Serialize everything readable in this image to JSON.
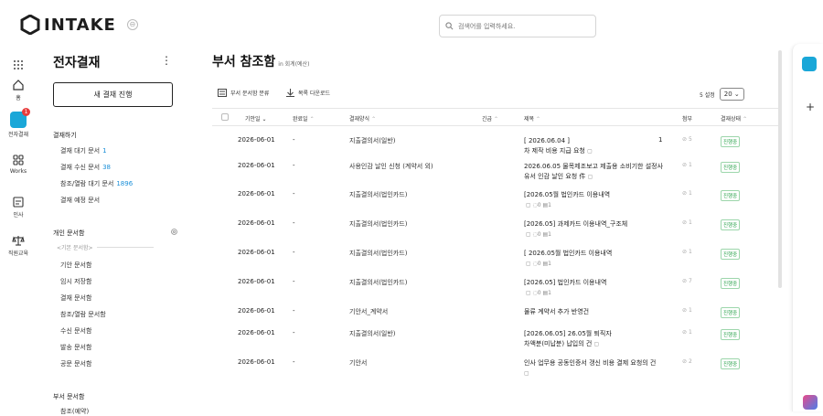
{
  "brand": {
    "name": "INTAKE"
  },
  "search": {
    "placeholder": "검색어를 입력하세요."
  },
  "rail": {
    "home": "홈",
    "approval": "전자결재",
    "approval_badge": "1",
    "works": "Works",
    "hr": "인사",
    "edu": "직원교육"
  },
  "sidebar": {
    "title": "전자결재",
    "new_button": "새 결재 진행",
    "section_approve": "결재하기",
    "items_approve": [
      {
        "label": "결재 대기 문서",
        "count": "1"
      },
      {
        "label": "결재 수신 문서",
        "count": "38"
      },
      {
        "label": "참조/열람 대기 문서",
        "count": "1896"
      },
      {
        "label": "결재 예정 문서",
        "count": ""
      }
    ],
    "section_personal": "개인 문서함",
    "divider_label": "<기본 문서함>",
    "items_personal": [
      "기안 문서함",
      "임시 저장함",
      "결재 문서함",
      "참조/열람 문서함",
      "수신 문서함",
      "발송 문서함",
      "공문 문서함"
    ],
    "section_dept": "부서 문서함",
    "dept_partial": "참조(예약)"
  },
  "main": {
    "title": "부서 참조함",
    "subtitle": "in 회계(예산)",
    "tool_classify": "부서 문서함 분류",
    "tool_download": "목록 다운로드",
    "page_size_label": "5 설정",
    "page_size": "20"
  },
  "table": {
    "headers": {
      "draft_date": "기안일",
      "done_date": "완료일",
      "form": "결재양식",
      "urgent": "긴급",
      "title": "제목",
      "attach": "첨부",
      "status": "결재상태"
    },
    "rows": [
      {
        "date": "2026-06-01",
        "done": "-",
        "form": "지출결의서(일반)",
        "title": "[ 2026.06.04 ]",
        "title2": "차 제작 비용 지급 요청",
        "num": "1",
        "att": "5",
        "status": "진행중"
      },
      {
        "date": "2026-06-01",
        "done": "-",
        "form": "사용인감 날인 신청 (계약서 외)",
        "title": "2026.06.05 물목제조보고 제출용 소비기한 설정사",
        "title2": "유서 인감 날인 요청 件",
        "num": "",
        "att": "1",
        "status": "진행중"
      },
      {
        "date": "2026-06-01",
        "done": "-",
        "form": "지출결의서(법인카드)",
        "title": "[2026.05월 법인카드 이용내역",
        "title2": "",
        "num": "",
        "att": "1",
        "status": "진행중"
      },
      {
        "date": "2026-06-01",
        "done": "-",
        "form": "지출결의서(법인카드)",
        "title": "[2026.05] 과제카드 이용내역_구조체",
        "title2": "",
        "num": "",
        "att": "1",
        "status": "진행중"
      },
      {
        "date": "2026-06-01",
        "done": "-",
        "form": "지출결의서(법인카드)",
        "title": "[ 2026.05월 법인카드 이용내역",
        "title2": "",
        "num": "",
        "att": "1",
        "status": "진행중"
      },
      {
        "date": "2026-06-01",
        "done": "-",
        "form": "지출결의서(법인카드)",
        "title": "[2026.05] 법인카드 이용내역",
        "title2": "",
        "num": "",
        "att": "7",
        "status": "진행중"
      },
      {
        "date": "2026-06-01",
        "done": "-",
        "form": "기안서_계약서",
        "title": "물류 계약서 추가 반영건",
        "title2": "",
        "num": "",
        "att": "1",
        "status": "진행중"
      },
      {
        "date": "2026-06-01",
        "done": "-",
        "form": "지출결의서(일반)",
        "title": "[2026.06.05] 26.05월 퇴직자",
        "title2": "차액분(미납분) 납입의 건",
        "num": "",
        "att": "1",
        "status": "진행중"
      },
      {
        "date": "2026-06-01",
        "done": "-",
        "form": "기안서",
        "title": "인사 업무용 공동인증서 갱신 비용 결제 요청의 건",
        "title2": "",
        "num": "",
        "att": "2",
        "status": "진행중"
      }
    ],
    "meta": {
      "comments": "0",
      "files": "1"
    }
  },
  "colors": {
    "accent": "#1aa7d8",
    "status_green": "#2da44e",
    "count_blue": "#1a8fd8"
  }
}
